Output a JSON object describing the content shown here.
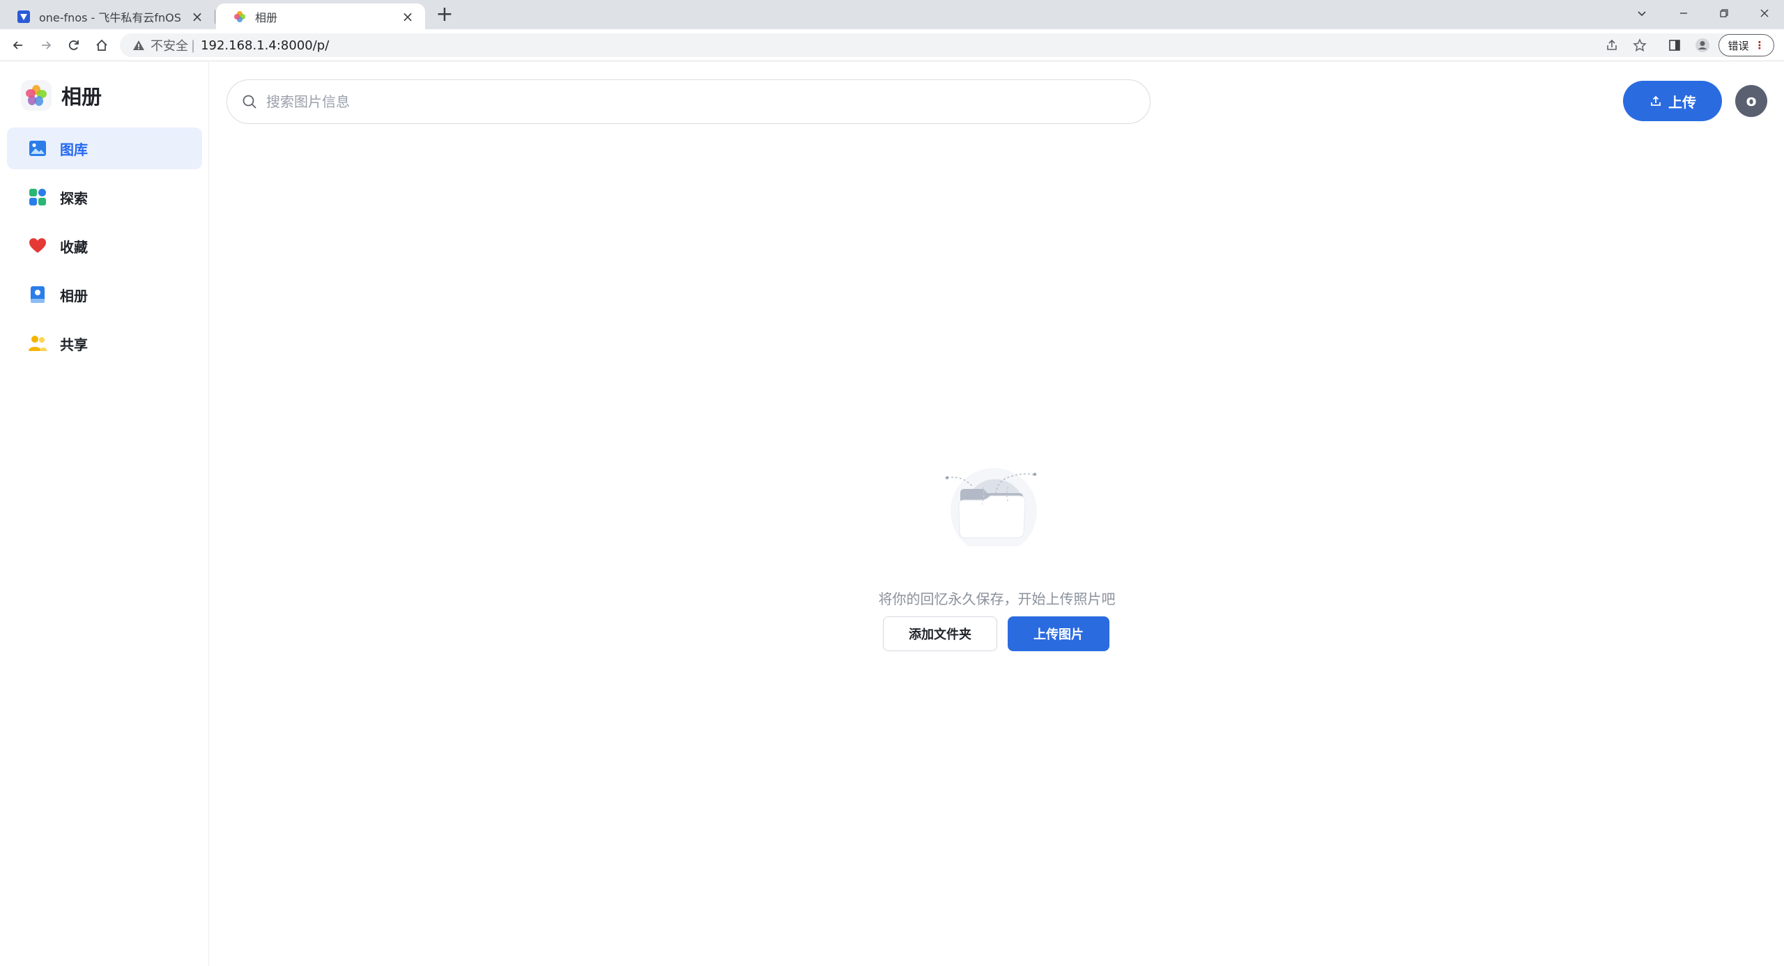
{
  "browser": {
    "tabs": [
      {
        "title": "one-fnos - 飞牛私有云fnOS",
        "active": false
      },
      {
        "title": "相册",
        "active": true
      }
    ],
    "address": {
      "security_label": "不安全",
      "separator": "|",
      "url": "192.168.1.4:8000/p/"
    },
    "error_pill": "错误"
  },
  "app": {
    "brand_title": "相册",
    "menu": [
      {
        "label": "图库",
        "icon": "gallery-icon",
        "active": true
      },
      {
        "label": "探索",
        "icon": "explore-icon",
        "active": false
      },
      {
        "label": "收藏",
        "icon": "heart-icon",
        "active": false
      },
      {
        "label": "相册",
        "icon": "album-icon",
        "active": false
      },
      {
        "label": "共享",
        "icon": "share-people-icon",
        "active": false
      }
    ],
    "search": {
      "placeholder": "搜索图片信息"
    },
    "upload_button": "上传",
    "avatar_initial": "o",
    "empty_state": {
      "message": "将你的回忆永久保存，开始上传照片吧",
      "add_folder_button": "添加文件夹",
      "upload_photos_button": "上传图片"
    }
  },
  "colors": {
    "primary": "#2a6be0",
    "active_menu_bg": "#eaf1fd",
    "active_menu_text": "#2468f2"
  }
}
